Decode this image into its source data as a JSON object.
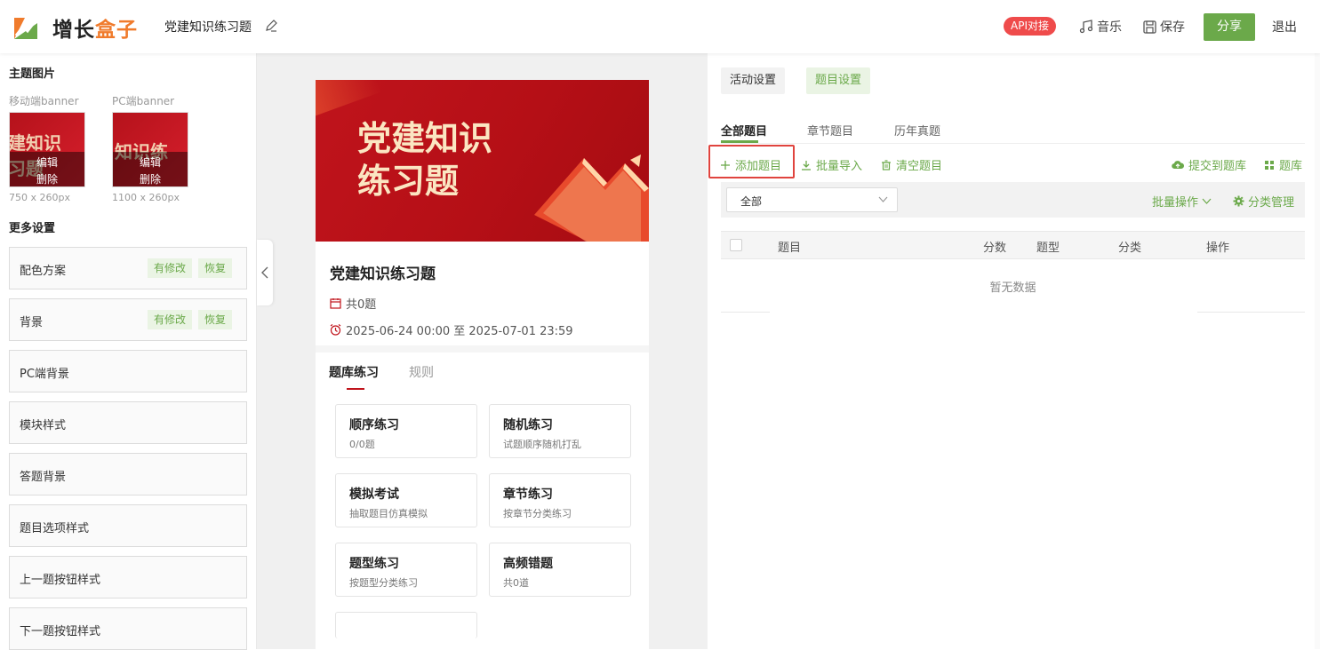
{
  "header": {
    "logo_main": "增长",
    "logo_accent": "盒子",
    "doc_title": "党建知识练习题",
    "api_badge": "API对接",
    "music": "音乐",
    "save": "保存",
    "share": "分享",
    "exit": "退出"
  },
  "left": {
    "theme_image_title": "主题图片",
    "mobile_banner_label": "移动端banner",
    "pc_banner_label": "PC端banner",
    "mobile_banner_text": "建知识",
    "mobile_banner_text2": "习题",
    "pc_banner_text": "知识练",
    "edit": "编辑",
    "delete": "删除",
    "mobile_size": "750 x 260px",
    "pc_size": "1100 x 260px",
    "more_settings_title": "更多设置",
    "modified": "有修改",
    "restore": "恢复",
    "items": [
      {
        "label": "配色方案"
      },
      {
        "label": "背景"
      },
      {
        "label": "PC端背景"
      },
      {
        "label": "模块样式"
      },
      {
        "label": "答题背景"
      },
      {
        "label": "题目选项样式"
      },
      {
        "label": "上一题按钮样式"
      },
      {
        "label": "下一题按钮样式"
      }
    ]
  },
  "preview": {
    "hero_line1": "党建知识",
    "hero_line2": "练习题",
    "title": "党建知识练习题",
    "count": "共0题",
    "time": "2025-06-24 00:00 至 2025-07-01 23:59",
    "tab_active": "题库练习",
    "tab_inactive": "规则",
    "modes": [
      {
        "title": "顺序练习",
        "sub": "0/0题"
      },
      {
        "title": "随机练习",
        "sub": "试题顺序随机打乱"
      },
      {
        "title": "模拟考试",
        "sub": "抽取题目仿真模拟"
      },
      {
        "title": "章节练习",
        "sub": "按章节分类练习"
      },
      {
        "title": "题型练习",
        "sub": "按题型分类练习"
      },
      {
        "title": "高频错题",
        "sub": "共0道"
      }
    ]
  },
  "right": {
    "tab_activity": "活动设置",
    "tab_question": "题目设置",
    "qtab_all": "全部题目",
    "qtab_chapter": "章节题目",
    "qtab_history": "历年真题",
    "add_question": "添加题目",
    "batch_import": "批量导入",
    "clear_questions": "清空题目",
    "submit_bank": "提交到题库",
    "bank": "题库",
    "filter_value": "全部",
    "batch_ops": "批量操作",
    "category_manage": "分类管理",
    "columns": [
      "题目",
      "分数",
      "题型",
      "分类",
      "操作"
    ],
    "empty": "暂无数据"
  },
  "colors": {
    "accent_green": "#6ba94a",
    "brand_orange": "#f07b2c",
    "api_red": "#ef4b4b",
    "hero_red": "#c0141c",
    "highlight_red": "#e0443e"
  }
}
